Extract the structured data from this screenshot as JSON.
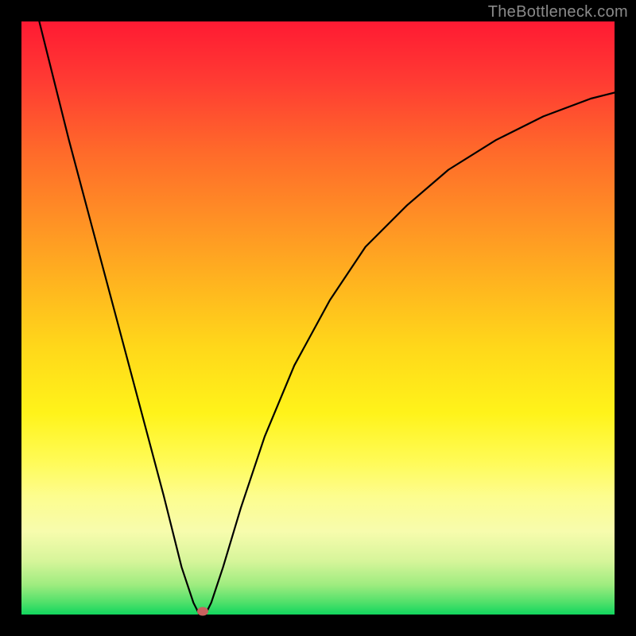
{
  "watermark": "TheBottleneck.com",
  "colors": {
    "frame": "#000000",
    "curve": "#000000",
    "marker": "#c9615e",
    "gradient_top": "#ff1a33",
    "gradient_bottom": "#12d65e"
  },
  "chart_data": {
    "type": "line",
    "title": "",
    "xlabel": "",
    "ylabel": "",
    "xlim": [
      0,
      100
    ],
    "ylim": [
      0,
      100
    ],
    "grid": false,
    "series": [
      {
        "name": "bottleneck-curve",
        "x": [
          3,
          5,
          8,
          12,
          16,
          20,
          24,
          27,
          29,
          30,
          31,
          32,
          34,
          37,
          41,
          46,
          52,
          58,
          65,
          72,
          80,
          88,
          96,
          100
        ],
        "y": [
          100,
          92,
          80,
          65,
          50,
          35,
          20,
          8,
          2,
          0,
          0,
          2,
          8,
          18,
          30,
          42,
          53,
          62,
          69,
          75,
          80,
          84,
          87,
          88
        ]
      }
    ],
    "annotations": [
      {
        "name": "min-marker",
        "x": 30.5,
        "y": 0.5
      }
    ]
  }
}
